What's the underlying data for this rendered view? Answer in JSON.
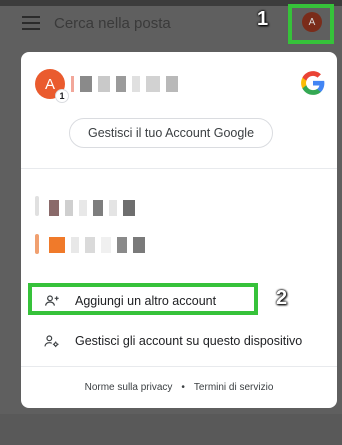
{
  "search": {
    "placeholder": "Cerca nella posta"
  },
  "top_avatar": {
    "initial": "A"
  },
  "annotations": {
    "step1": "1",
    "step2": "2",
    "highlight_color": "#36c23a"
  },
  "account_card": {
    "avatar_initial": "A",
    "avatar_count": "1",
    "avatar_color": "#ea5b2e",
    "manage_button_label": "Gestisci il tuo Account Google",
    "add_account_label": "Aggiungi un altro account",
    "manage_device_label": "Gestisci gli account su questo dispositivo",
    "privacy_link": "Norme sulla privacy",
    "separator": "•",
    "terms_link": "Termini di servizio"
  },
  "icons": {
    "menu": "menu-icon",
    "google": "google-logo-icon",
    "add_account": "person-add-icon",
    "manage_accounts": "manage-accounts-icon"
  },
  "colors": {
    "scrim": "#5f5f5f",
    "card": "#ffffff",
    "google_blue": "#4285f4",
    "google_red": "#ea4335",
    "google_yellow": "#fbbc05",
    "google_green": "#34a853"
  }
}
